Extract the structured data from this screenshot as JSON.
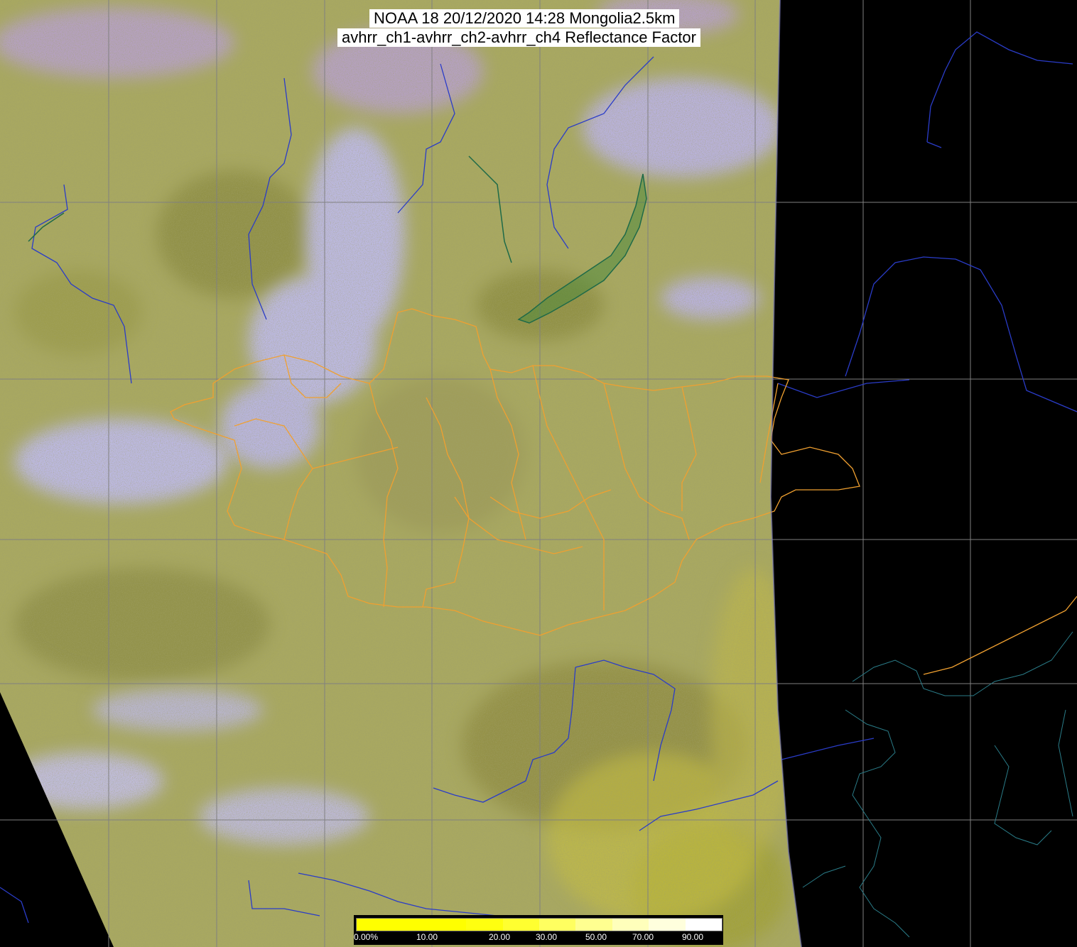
{
  "title": {
    "line1": "NOAA 18 20/12/2020 14:28 Mongolia2.5km",
    "line2": "avhrr_ch1-avhrr_ch2-avhrr_ch4 Reflectance Factor"
  },
  "legend": {
    "tick_labels": [
      "0.00%",
      "10.00",
      "20.00",
      "30.00",
      "50.00",
      "70.00",
      "90.00"
    ],
    "gradient_colors": [
      "#ffff00",
      "#ffff00",
      "#ffff00",
      "#ffff10",
      "#ffff30",
      "#ffff60",
      "#ffff90",
      "#ffffbb",
      "#ffffdd",
      "#ffffff"
    ]
  },
  "colors": {
    "no_data": "#000000",
    "land_terrain": "#a8a860",
    "cloud": "#b8b4f0",
    "rivers_coast": "#2a3cc8",
    "province_borders": "#f0a030",
    "graticule": "#808080",
    "lake_baikal": "#2e7a58"
  }
}
